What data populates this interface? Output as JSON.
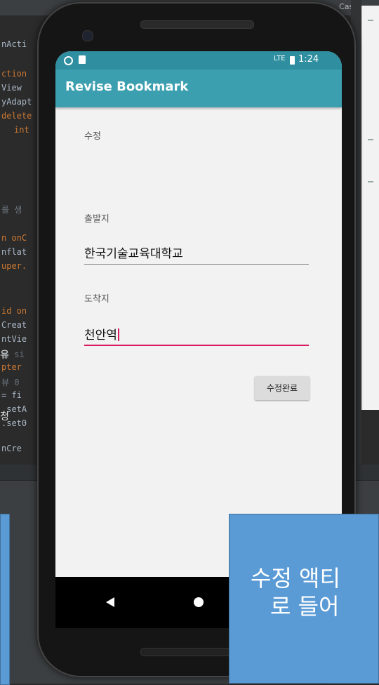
{
  "ide": {
    "case_label": "Case",
    "code_fragments": [
      "nActi",
      "ction",
      "View",
      "yAdapt",
      "delete",
      "int",
      "를 생",
      "n onC",
      "nflat",
      "uper.",
      "id on",
      "Creat",
      "ntVie",
      "를 si",
      "pter",
      "뷰 0",
      "= fi",
      ".setA",
      ".set0",
      "nCre"
    ],
    "side_chars": [
      "유",
      "정"
    ]
  },
  "app": {
    "status_time": "1:24",
    "status_network": "LTE",
    "title": "Revise Bookmark",
    "section_label": "수정",
    "departure_label": "출발지",
    "departure_value": "한국기술교육대학교",
    "arrival_label": "도착지",
    "arrival_value": "천안역",
    "submit_button": "수정완료"
  },
  "nav": {
    "back": "back-icon",
    "home": "home-icon"
  },
  "callout": {
    "line1": "수정 액티",
    "line2": "로 들어"
  },
  "colors": {
    "statusbar": "#2f8fa0",
    "appbar": "#3c9fb0",
    "accent": "#d81b60",
    "callout": "#5b9bd5"
  }
}
